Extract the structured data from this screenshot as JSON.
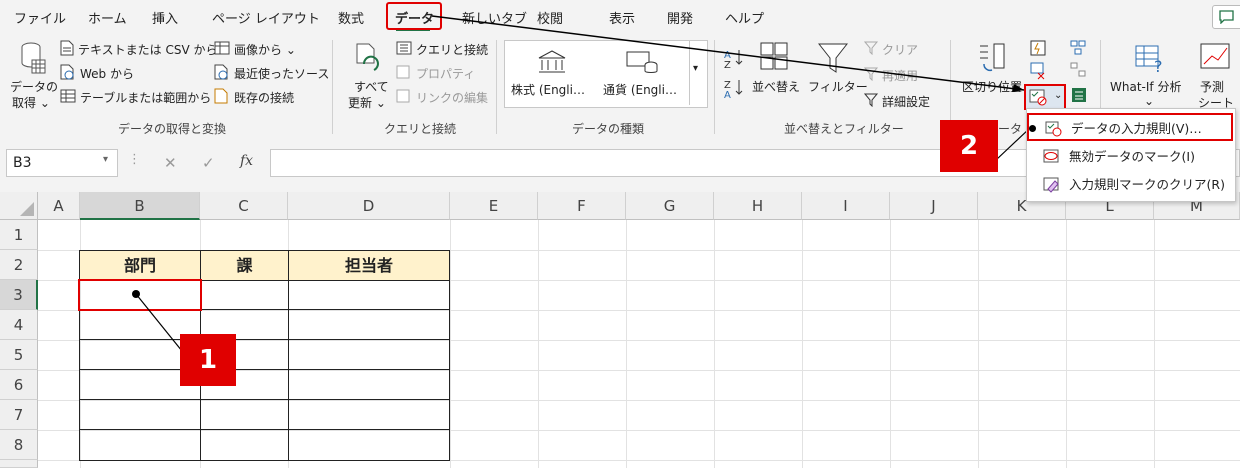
{
  "tabs": [
    "ファイル",
    "ホーム",
    "挿入",
    "ページ レイアウト",
    "数式",
    "データ",
    "新しいタブ",
    "校閲",
    "表示",
    "開発",
    "ヘルプ"
  ],
  "active_tab": "データ",
  "ribbon": {
    "get_data": {
      "line1": "データの",
      "line2": "取得 ⌄"
    },
    "text_csv": "テキストまたは CSV から",
    "web": "Web から",
    "table_range": "テーブルまたは範囲から",
    "from_image": "画像から ⌄",
    "recent_sources": "最近使ったソース",
    "existing_conn": "既存の接続",
    "refresh_all": {
      "line1": "すべて",
      "line2": "更新 ⌄"
    },
    "queries_conn": "クエリと接続",
    "properties": "プロパティ",
    "edit_links": "リンクの編集",
    "stocks": "株式 (Engli…",
    "currencies": "通貨 (Engli…",
    "sort": "並べ替え",
    "filter": "フィルター",
    "clear": "クリア",
    "reapply": "再適用",
    "advanced": "詳細設定",
    "text_to_columns": "区切り位置",
    "whatif": "What-If 分析",
    "whatif_arrow": "⌄",
    "forecast": {
      "line1": "予測",
      "line2": "シート"
    },
    "groups": [
      "データの取得と変換",
      "クエリと接続",
      "データの種類",
      "並べ替えとフィルター",
      "データ ツール"
    ]
  },
  "namebox": "B3",
  "formula_icons": {
    "cancel": "✕",
    "enter": "✓",
    "fx": "fx"
  },
  "columns": [
    "A",
    "B",
    "C",
    "D",
    "E",
    "F",
    "G",
    "H",
    "I",
    "J",
    "K",
    "L",
    "M"
  ],
  "rows": [
    "1",
    "2",
    "3",
    "4",
    "5",
    "6",
    "7",
    "8"
  ],
  "table_headers": [
    "部門",
    "課",
    "担当者"
  ],
  "dropdown": {
    "items": [
      "データの入力規則(V)…",
      "無効データのマーク(I)",
      "入力規則マークのクリア(R)"
    ]
  },
  "callouts": [
    "1",
    "2"
  ],
  "colors": {
    "accent_red": "#e00000",
    "header_fill": "#fff2cc",
    "excel_green": "#217346"
  }
}
